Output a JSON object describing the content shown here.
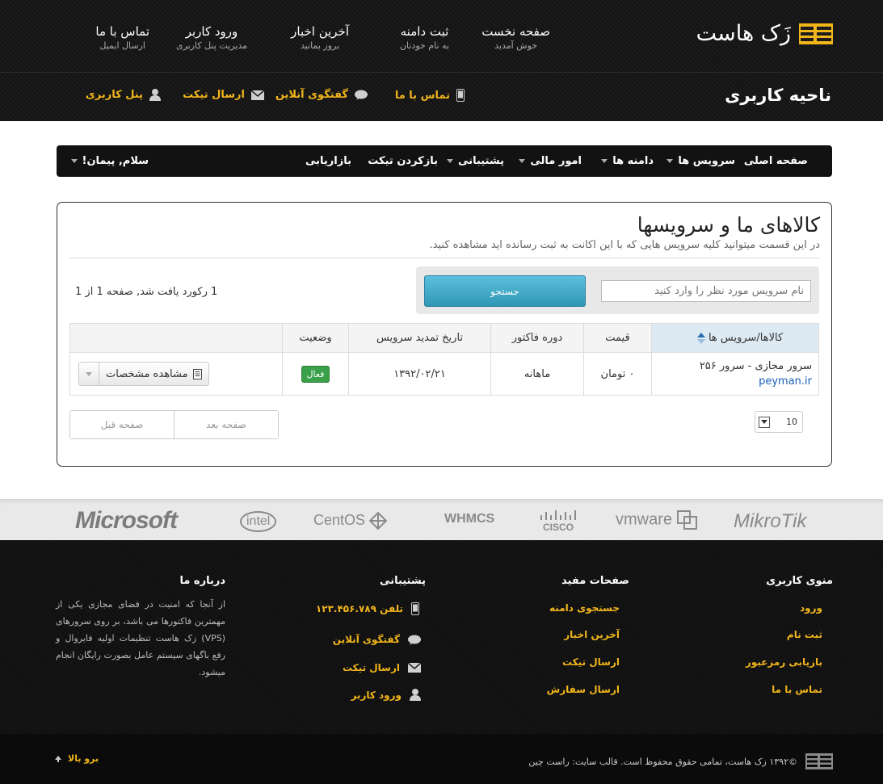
{
  "header": {
    "logo_text": "زَک هاست",
    "area_title": "ناحیه کاربری",
    "topnav": [
      {
        "title": "صفحه نخست",
        "subtitle": "خوش آمدید"
      },
      {
        "title": "ثبت دامنه",
        "subtitle": "به نام خودتان"
      },
      {
        "title": "آخرین اخبار",
        "subtitle": "بروز بمانید"
      },
      {
        "title": "ورود کاربر",
        "subtitle": "مدیریت پنل کاربری"
      },
      {
        "title": "تماس با ما",
        "subtitle": "ارسال ایمیل"
      }
    ],
    "quicklinks": {
      "contact": "تماس با ما",
      "chat": "گفتگوی آنلاین",
      "ticket": "ارسال تیکت",
      "panel": "پنل کاربری"
    }
  },
  "mainnav": {
    "home": "صفحه اصلی",
    "services": "سرویس ها",
    "domains": "دامنه ها",
    "billing": "امور مالی",
    "support": "پشتیبانی",
    "open_ticket": "بازکردن تیکت",
    "affiliates": "بازاریابی",
    "greeting": "سلام, پیمان!"
  },
  "content": {
    "title": "کالاهای ما و سرویسها",
    "subtitle": "در این قسمت میتوانید کلیه سرویس هایی که با این اکانت به ثبت رسانده اید مشاهده کنید.",
    "search_placeholder": "نام سرویس مورد نظر را وارد کنید",
    "search_button": "جستجو",
    "records_text": "1 رکورد یافت شد, صفحه 1 از 1",
    "table": {
      "headers": [
        "کالاها/سرویس ها",
        "قیمت",
        "دوره فاکتور",
        "تاریخ تمدید سرویس",
        "وضعیت",
        ""
      ],
      "rows": [
        {
          "name": "سرور مجازی - سرور ۲۵۶",
          "domain": "peyman.ir",
          "price": "۰ تومان",
          "cycle": "ماهانه",
          "due_date": "۱۳۹۲/۰۲/۲۱",
          "status": "فعال",
          "action": "مشاهده مشخصات"
        }
      ]
    },
    "pager": {
      "next": "صفحه بعد",
      "prev": "صفحه قبل"
    },
    "per_page": "10"
  },
  "partners": [
    "Microsoft",
    "intel",
    "CentOS",
    "WHMCS",
    "CISCO",
    "vmware",
    "MikroTik"
  ],
  "footer": {
    "user_menu": {
      "title": "منوی کاربری",
      "links": [
        "ورود",
        "ثبت نام",
        "بازیابی رمزعبور",
        "تماس با ما"
      ]
    },
    "useful_pages": {
      "title": "صفحات مفید",
      "links": [
        "جستجوی دامنه",
        "آخرین اخبار",
        "ارسال تیکت",
        "ارسال سفارش"
      ]
    },
    "support": {
      "title": "پشتیبانی",
      "phone": "تلفن ۱۲۳.۴۵۶.۷۸۹",
      "chat": "گفتگوی آنلاین",
      "ticket": "ارسال تیکت",
      "login": "ورود کاربر"
    },
    "about": {
      "title": "درباره ما",
      "text": "از آنجا که امنیت در فضای مجازی یکی از مهمترین فاکتورها می باشد، بر روی سرورهای (VPS) زک هاست تنظیمات اولیه فایروال و رفع باگهای سیستم عامل بصورت رایگان انجام میشود."
    },
    "copyright": "©۱۳۹۲ زک هاست، تمامی حقوق محفوظ است. قالب سایت: راست چین",
    "back_to_top": "برو بالا"
  },
  "colors": {
    "accent": "#f2b61b",
    "search_button": "#3fa9d1",
    "status_active": "#3aa04a",
    "link": "#1a5fb4"
  }
}
